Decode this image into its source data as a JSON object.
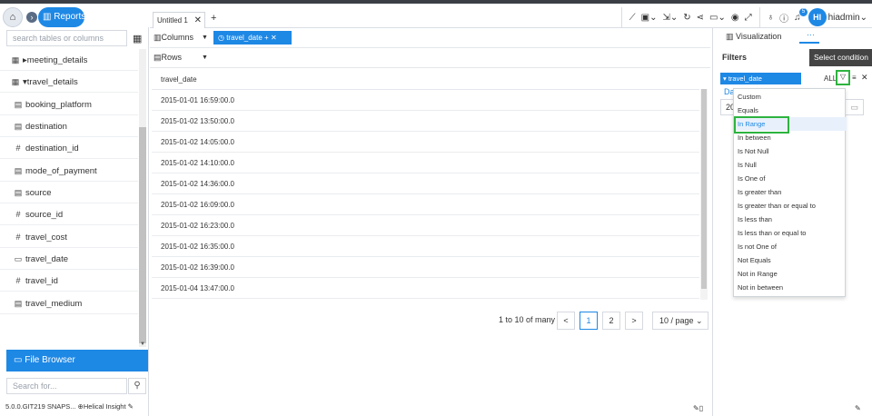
{
  "breadcrumb": {
    "home_icon": "home-icon",
    "reports_label": "Reports"
  },
  "left_panel": {
    "search_placeholder": "search tables or columns",
    "items": [
      {
        "label": "meeting_details",
        "icon": "table-icon",
        "expand": "▸"
      },
      {
        "label": "travel_details",
        "icon": "table-icon",
        "expand": "▾"
      },
      {
        "label": "booking_platform",
        "icon": "doc-icon"
      },
      {
        "label": "destination",
        "icon": "doc-icon"
      },
      {
        "label": "destination_id",
        "icon": "hash-icon"
      },
      {
        "label": "mode_of_payment",
        "icon": "doc-icon"
      },
      {
        "label": "source",
        "icon": "doc-icon"
      },
      {
        "label": "source_id",
        "icon": "hash-icon"
      },
      {
        "label": "travel_cost",
        "icon": "hash-icon"
      },
      {
        "label": "travel_date",
        "icon": "calendar-icon"
      },
      {
        "label": "travel_id",
        "icon": "hash-icon"
      },
      {
        "label": "travel_medium",
        "icon": "doc-icon"
      }
    ],
    "file_browser_label": "File Browser",
    "search_for_placeholder": "Search for...",
    "version": "5.0.0.GIT219 SNAPS...",
    "brand": "Helical Insight"
  },
  "tabs": [
    {
      "label": "Untitled 1"
    }
  ],
  "toolbar": {
    "username": "hiadmin",
    "avatar_initials": "HI",
    "notification_count": "5"
  },
  "columns": {
    "label": "Columns",
    "pill": "travel_date"
  },
  "rows": {
    "label": "Rows"
  },
  "table": {
    "header": "travel_date",
    "rows": [
      "2015-01-01 16:59:00.0",
      "2015-01-02 13:50:00.0",
      "2015-01-02 14:05:00.0",
      "2015-01-02 14:10:00.0",
      "2015-01-02 14:36:00.0",
      "2015-01-02 16:09:00.0",
      "2015-01-02 16:23:00.0",
      "2015-01-02 16:35:00.0",
      "2015-01-02 16:39:00.0",
      "2015-01-04 13:47:00.0"
    ]
  },
  "pagination": {
    "info": "1 to 10 of many",
    "prev": "<",
    "page1": "1",
    "page2": "2",
    "next": ">",
    "page_size": "10 / page"
  },
  "right_panel": {
    "viz_tab": "Visualization",
    "more": "···",
    "filters_title": "Filters",
    "tooltip": "Select condition",
    "filter_pill": "▾ travel_date",
    "all_label": "ALL",
    "date_label": "Da",
    "date_value": "20"
  },
  "dropdown": {
    "items": [
      "Custom",
      "Equals",
      "In Range",
      "In between",
      "Is Not Null",
      "Is Null",
      "Is One of",
      "Is greater than",
      "Is greater than or equal to",
      "Is less than",
      "Is less than or equal to",
      "Is not One of",
      "Not Equals",
      "Not in Range",
      "Not in between"
    ],
    "selected_index": 2
  },
  "colors": {
    "accent": "#1e88e5",
    "highlight": "#2db33f"
  }
}
